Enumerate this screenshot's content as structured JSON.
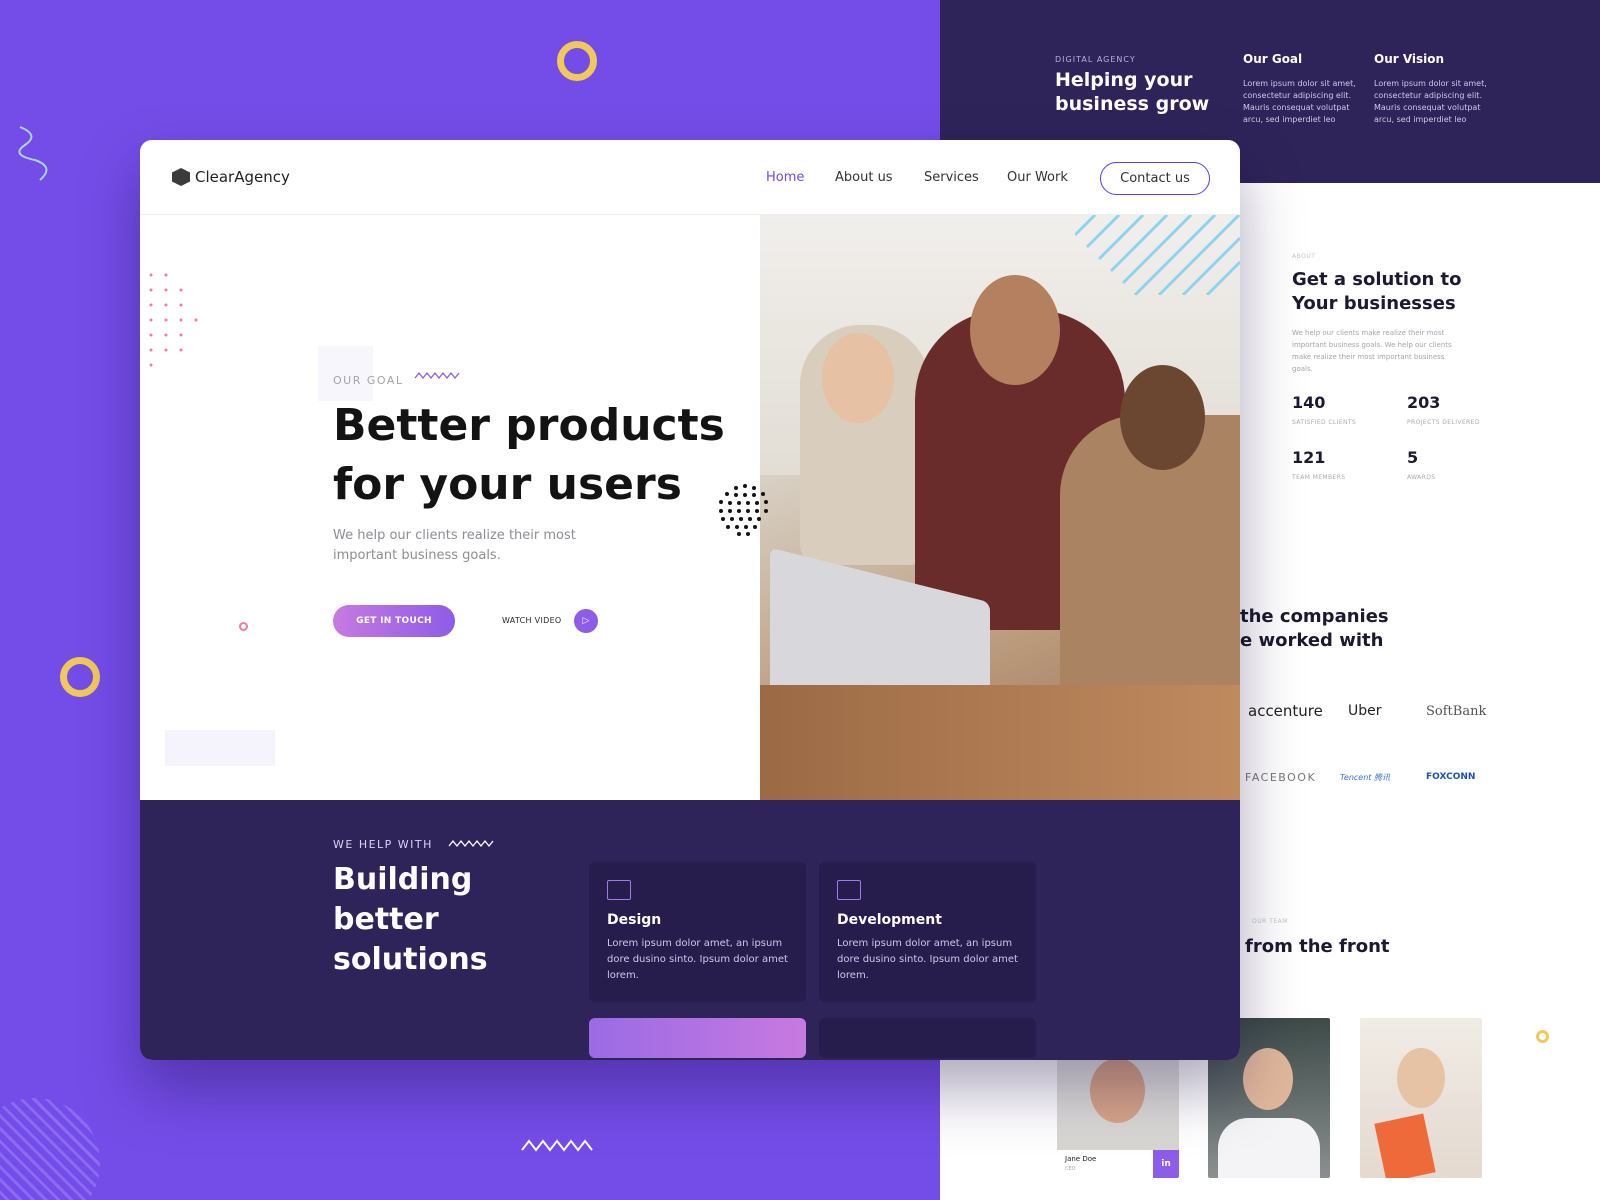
{
  "colors": {
    "primary": "#744de8",
    "dark": "#2f2459",
    "accent": "#f0c95a"
  },
  "site": {
    "brand": "ClearAgency",
    "nav": {
      "home": "Home",
      "about": "About us",
      "services": "Services",
      "work": "Our Work",
      "contact": "Contact us"
    },
    "hero": {
      "eyebrow": "OUR GOAL",
      "title": "Better products for your users",
      "subtitle": "We help our clients realize their most important business goals.",
      "cta": "GET IN TOUCH",
      "watch": "WATCH VIDEO"
    },
    "help": {
      "eyebrow": "WE HELP WITH",
      "title": "Building better solutions",
      "services": [
        {
          "title": "Design",
          "text": "Lorem ipsum dolor amet, an ipsum dore dusino sinto. Ipsum dolor amet lorem.",
          "icon": "monitor-design-icon"
        },
        {
          "title": "Development",
          "text": "Lorem ipsum dolor amet, an ipsum dore dusino sinto. Ipsum dolor amet lorem.",
          "icon": "monitor-code-icon"
        }
      ]
    }
  },
  "background_page": {
    "eyebrow": "DIGITAL AGENCY",
    "headline": "Helping your business grow",
    "goal": {
      "title": "Our Goal",
      "text": "Lorem ipsum dolor sit amet, consectetur adipiscing elit. Mauris consequat volutpat arcu, sed imperdiet leo"
    },
    "vision": {
      "title": "Our Vision",
      "text": "Lorem ipsum dolor sit amet, consectetur adipiscing elit. Mauris consequat volutpat arcu, sed imperdiet leo"
    },
    "about_label": "ABOUT",
    "about_title": "Get a solution to Your businesses",
    "about_text": "We help our clients make realize their most important business goals. We help our clients make realize their most important business goals.",
    "stats": [
      {
        "value": "140",
        "label": "SATISFIED CLIENTS"
      },
      {
        "value": "203",
        "label": "PROJECTS DELIVERED"
      },
      {
        "value": "121",
        "label": "TEAM MEMBERS"
      },
      {
        "value": "5",
        "label": "AWARDS"
      }
    ],
    "companies_title_1": "the companies",
    "companies_title_2": "e worked with",
    "logos": [
      "accenture",
      "Uber",
      "SoftBank",
      "FACEBOOK",
      "Tencent 腾讯",
      "FOXCONN"
    ],
    "team_label": "OUR TEAM",
    "team_title": "from the front",
    "member": {
      "name": "Jane Doe",
      "role": "CEO",
      "social": "in"
    }
  }
}
